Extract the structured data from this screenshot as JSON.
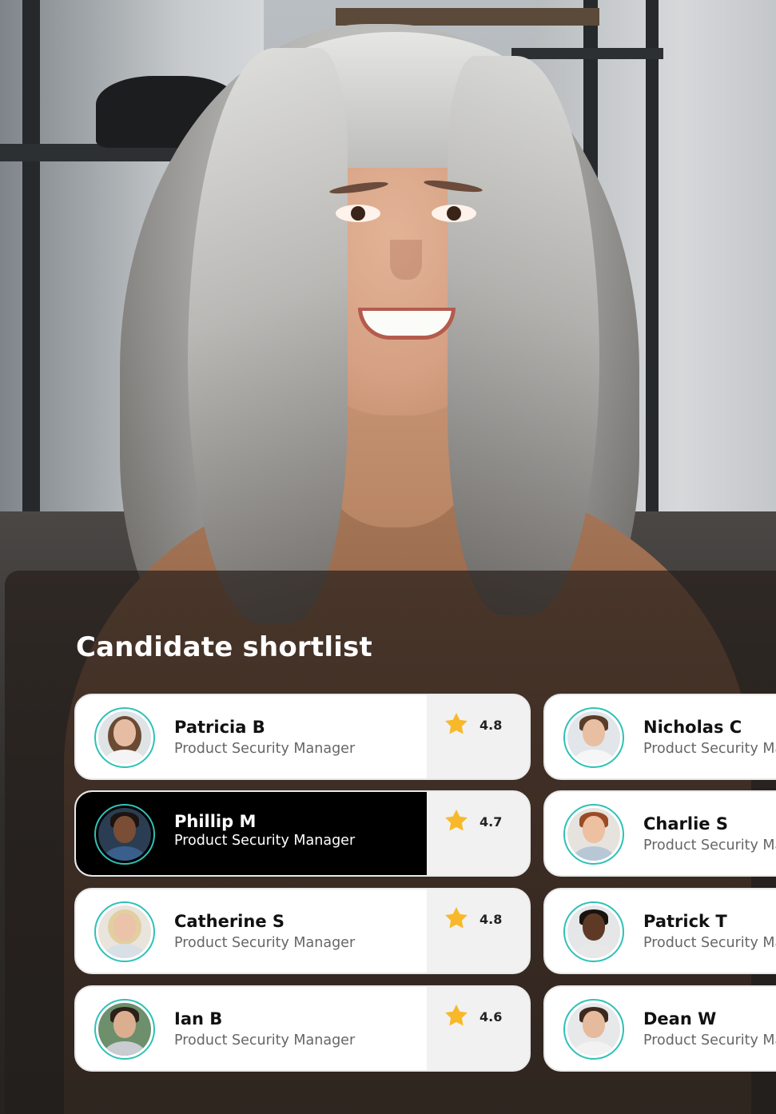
{
  "section": {
    "title": "Candidate shortlist"
  },
  "colors": {
    "accent_ring": "#2fc1b6",
    "star": "#f7b92a",
    "selected_bg": "#000000",
    "rating_bg": "#f1f1f1"
  },
  "candidates_left": [
    {
      "name": "Patricia B",
      "role": "Product Security Manager",
      "rating": "4.8",
      "selected": false
    },
    {
      "name": "Phillip M",
      "role": "Product Security Manager",
      "rating": "4.7",
      "selected": true
    },
    {
      "name": "Catherine S",
      "role": "Product Security Manager",
      "rating": "4.8",
      "selected": false
    },
    {
      "name": "Ian B",
      "role": "Product Security Manager",
      "rating": "4.6",
      "selected": false
    }
  ],
  "candidates_right": [
    {
      "name": "Nicholas C",
      "role": "Product Security Manager"
    },
    {
      "name": "Charlie S",
      "role": "Product Security Manager"
    },
    {
      "name": "Patrick T",
      "role": "Product Security Manager"
    },
    {
      "name": "Dean W",
      "role": "Product Security Manager"
    }
  ],
  "icons": {
    "rating": "star-icon",
    "avatar": "avatar"
  }
}
